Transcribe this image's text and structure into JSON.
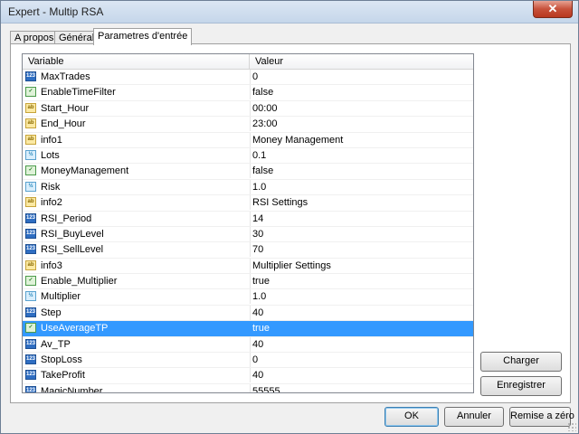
{
  "window": {
    "title": "Expert - Multip RSA",
    "close_label": "✕"
  },
  "tabs": [
    {
      "label": "A propos",
      "active": false
    },
    {
      "label": "Général",
      "active": false
    },
    {
      "label": "Parametres d'entrée",
      "active": true
    }
  ],
  "table": {
    "columns": [
      "Variable",
      "Valeur"
    ],
    "rows": [
      {
        "name": "MaxTrades",
        "value": "0",
        "type": "int"
      },
      {
        "name": "EnableTimeFilter",
        "value": "false",
        "type": "bool"
      },
      {
        "name": "Start_Hour",
        "value": "00:00",
        "type": "str"
      },
      {
        "name": "End_Hour",
        "value": "23:00",
        "type": "str"
      },
      {
        "name": "info1",
        "value": " Money Management",
        "type": "str"
      },
      {
        "name": "Lots",
        "value": "0.1",
        "type": "dbl"
      },
      {
        "name": "MoneyManagement",
        "value": "false",
        "type": "bool"
      },
      {
        "name": "Risk",
        "value": "1.0",
        "type": "dbl"
      },
      {
        "name": "info2",
        "value": " RSI Settings",
        "type": "str"
      },
      {
        "name": "RSI_Period",
        "value": "14",
        "type": "int"
      },
      {
        "name": "RSI_BuyLevel",
        "value": "30",
        "type": "int"
      },
      {
        "name": "RSI_SellLevel",
        "value": "70",
        "type": "int"
      },
      {
        "name": "info3",
        "value": " Multiplier Settings",
        "type": "str"
      },
      {
        "name": "Enable_Multiplier",
        "value": "true",
        "type": "bool"
      },
      {
        "name": "Multiplier",
        "value": "1.0",
        "type": "dbl"
      },
      {
        "name": "Step",
        "value": "40",
        "type": "int"
      },
      {
        "name": "UseAverageTP",
        "value": "true",
        "type": "bool",
        "selected": true
      },
      {
        "name": "Av_TP",
        "value": "40",
        "type": "int"
      },
      {
        "name": "StopLoss",
        "value": "0",
        "type": "int"
      },
      {
        "name": "TakeProfit",
        "value": "40",
        "type": "int"
      },
      {
        "name": "MagicNumber",
        "value": "55555",
        "type": "int"
      }
    ]
  },
  "icons": {
    "int": "123",
    "bool": "✓",
    "str": "ab",
    "dbl": "½"
  },
  "side_buttons": {
    "load_label": "Charger",
    "save_label": "Enregistrer"
  },
  "buttons": {
    "ok_label": "OK",
    "cancel_label": "Annuler",
    "reset_label": "Remise a zéro"
  },
  "colors": {
    "selection": "#3399ff"
  }
}
